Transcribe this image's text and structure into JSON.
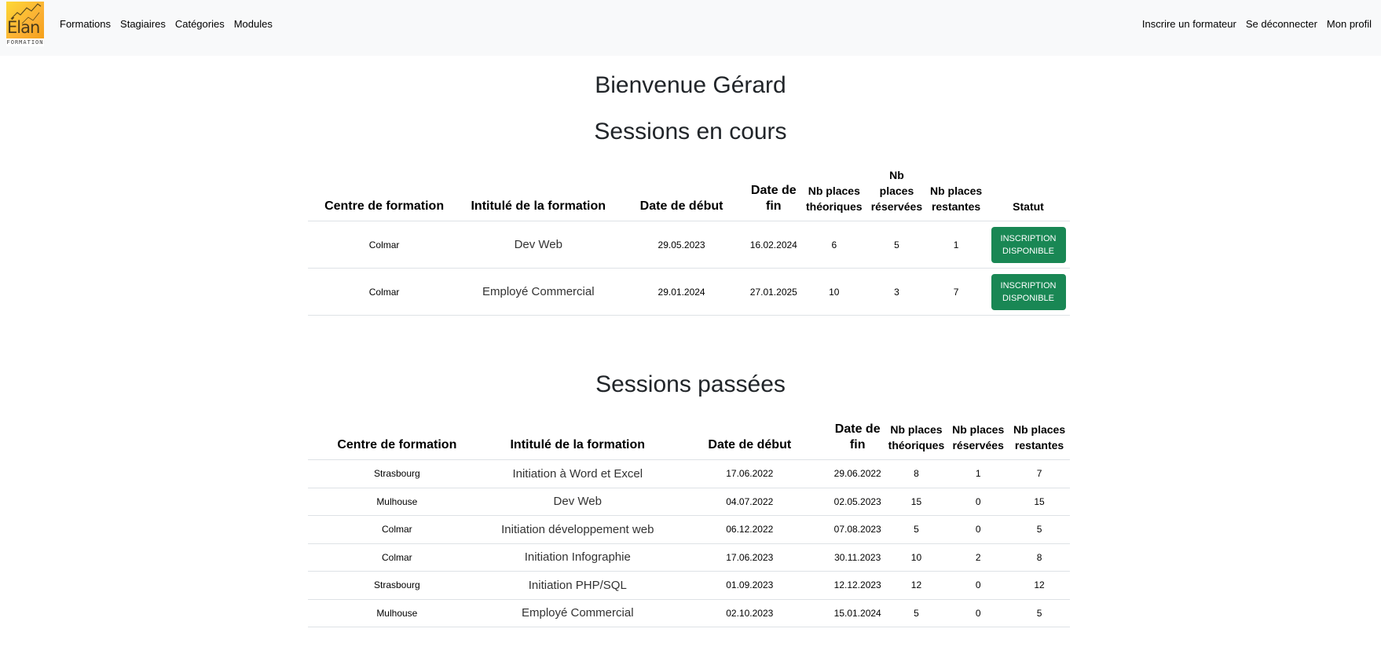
{
  "logo": {
    "word": "Élan",
    "sub": "FORMATION"
  },
  "nav": {
    "left": [
      "Formations",
      "Stagiaires",
      "Catégories",
      "Modules"
    ],
    "right": [
      "Inscrire un formateur",
      "Se déconnecter",
      "Mon profil"
    ]
  },
  "welcome": "Bienvenue Gérard",
  "current": {
    "heading": "Sessions en cours",
    "columns": [
      "Centre de formation",
      "Intitulé de la formation",
      "Date de début",
      "Date de fin",
      "Nb places théoriques",
      "Nb places réservées",
      "Nb places restantes",
      "Statut"
    ],
    "rows": [
      {
        "centre": "Colmar",
        "title": "Dev Web",
        "start": "29.05.2023",
        "end": "16.02.2024",
        "theo": "6",
        "reserved": "5",
        "remaining": "1",
        "status": "Inscription disponible"
      },
      {
        "centre": "Colmar",
        "title": "Employé Commercial",
        "start": "29.01.2024",
        "end": "27.01.2025",
        "theo": "10",
        "reserved": "3",
        "remaining": "7",
        "status": "Inscription disponible"
      }
    ]
  },
  "past": {
    "heading": "Sessions passées",
    "columns": [
      "Centre de formation",
      "Intitulé de la formation",
      "Date de début",
      "Date de fin",
      "Nb places théoriques",
      "Nb places réservées",
      "Nb places restantes"
    ],
    "rows": [
      {
        "centre": "Strasbourg",
        "title": "Initiation à Word et Excel",
        "start": "17.06.2022",
        "end": "29.06.2022",
        "theo": "8",
        "reserved": "1",
        "remaining": "7"
      },
      {
        "centre": "Mulhouse",
        "title": "Dev Web",
        "start": "04.07.2022",
        "end": "02.05.2023",
        "theo": "15",
        "reserved": "0",
        "remaining": "15"
      },
      {
        "centre": "Colmar",
        "title": "Initiation développement web",
        "start": "06.12.2022",
        "end": "07.08.2023",
        "theo": "5",
        "reserved": "0",
        "remaining": "5"
      },
      {
        "centre": "Colmar",
        "title": "Initiation Infographie",
        "start": "17.06.2023",
        "end": "30.11.2023",
        "theo": "10",
        "reserved": "2",
        "remaining": "8"
      },
      {
        "centre": "Strasbourg",
        "title": "Initiation PHP/SQL",
        "start": "01.09.2023",
        "end": "12.12.2023",
        "theo": "12",
        "reserved": "0",
        "remaining": "12"
      },
      {
        "centre": "Mulhouse",
        "title": "Employé Commercial",
        "start": "02.10.2023",
        "end": "15.01.2024",
        "theo": "5",
        "reserved": "0",
        "remaining": "5"
      }
    ]
  },
  "colors": {
    "navbar_bg": "#f8f9fa",
    "status_green": "#198754"
  }
}
